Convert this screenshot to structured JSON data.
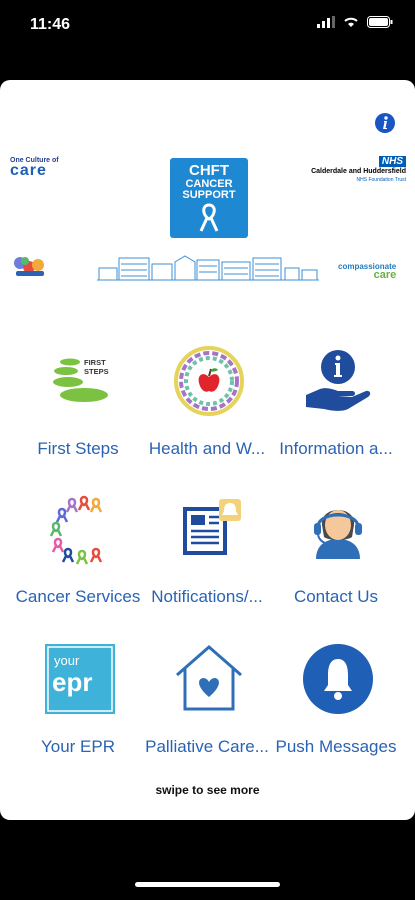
{
  "status_bar": {
    "time": "11:46"
  },
  "header": {
    "logo_left_line1": "One Culture of",
    "logo_left_line2": "care",
    "badge_line1": "CHFT",
    "badge_line2": "CANCER",
    "badge_line3": "SUPPORT",
    "nhs_logo": "NHS",
    "nhs_name": "Calderdale and Huddersfield",
    "nhs_trust": "NHS Foundation Trust",
    "compass_line1": "compassionate",
    "compass_line2": "care"
  },
  "tiles": [
    {
      "label": "First Steps",
      "icon": "first-steps-icon",
      "icon_text1": "FIRST",
      "icon_text2": "STEPS"
    },
    {
      "label": "Health and W...",
      "icon": "health-apple-icon"
    },
    {
      "label": "Information a...",
      "icon": "information-hand-icon"
    },
    {
      "label": "Cancer Services",
      "icon": "ribbons-icon"
    },
    {
      "label": "Notifications/...",
      "icon": "newspaper-bell-icon"
    },
    {
      "label": "Contact Us",
      "icon": "headset-person-icon"
    },
    {
      "label": "Your EPR",
      "icon": "your-epr-icon",
      "icon_text1": "your",
      "icon_text2": "epr"
    },
    {
      "label": "Palliative Care...",
      "icon": "house-heart-icon"
    },
    {
      "label": "Push Messages",
      "icon": "bell-icon"
    }
  ],
  "footer": {
    "swipe_hint": "swipe to see more"
  },
  "colors": {
    "accent": "#2a63b4",
    "badge": "#1e88d2",
    "nhs": "#005eb8"
  }
}
